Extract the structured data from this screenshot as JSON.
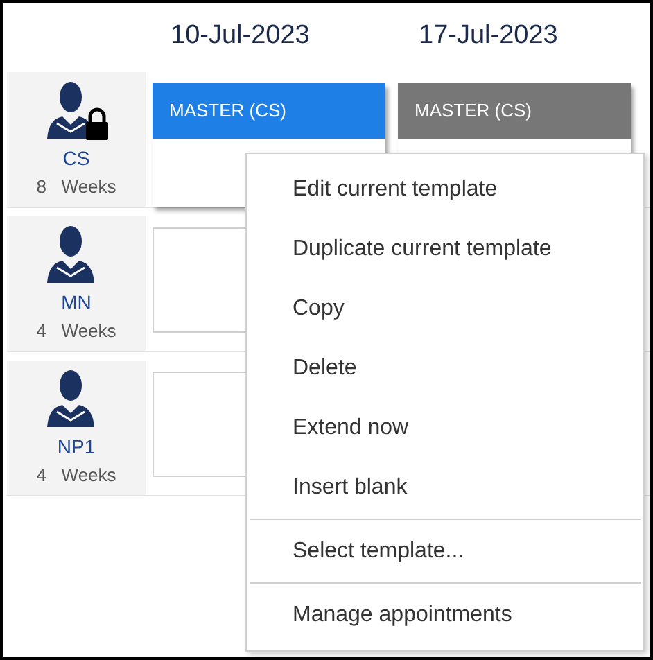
{
  "dates": [
    "10-Jul-2023",
    "17-Jul-2023"
  ],
  "staff": [
    {
      "name": "CS",
      "weeks": "8",
      "unit": "Weeks",
      "locked": true,
      "cards": [
        {
          "kind": "template",
          "title": "MASTER (CS)",
          "selected": true
        },
        {
          "kind": "template",
          "title": "MASTER (CS)",
          "selected": false
        }
      ]
    },
    {
      "name": "MN",
      "weeks": "4",
      "unit": "Weeks",
      "locked": false,
      "cards": [
        {
          "kind": "empty"
        }
      ]
    },
    {
      "name": "NP1",
      "weeks": "4",
      "unit": "Weeks",
      "locked": false,
      "cards": [
        {
          "kind": "empty"
        }
      ]
    }
  ],
  "context_menu": [
    {
      "label": "Edit current template",
      "separator_before": false
    },
    {
      "label": "Duplicate current template",
      "separator_before": false
    },
    {
      "label": "Copy",
      "separator_before": false
    },
    {
      "label": "Delete",
      "separator_before": false
    },
    {
      "label": "Extend now",
      "separator_before": false
    },
    {
      "label": "Insert blank",
      "separator_before": false
    },
    {
      "label": "Select template...",
      "separator_before": true
    },
    {
      "label": "Manage appointments",
      "separator_before": true
    }
  ]
}
